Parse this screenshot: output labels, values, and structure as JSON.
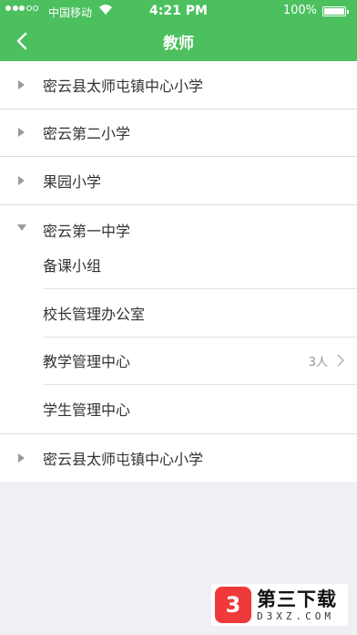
{
  "status_bar": {
    "carrier": "中国移动",
    "time": "4:21 PM",
    "battery": "100%"
  },
  "nav": {
    "title": "教师",
    "back_icon": "chevron-left-icon"
  },
  "schools": [
    {
      "name": "密云县太师屯镇中心小学"
    },
    {
      "name": "密云第二小学"
    },
    {
      "name": "果园小学"
    }
  ],
  "expanded_school": {
    "name": "密云第一中学",
    "groups": [
      {
        "name": "备课小组"
      },
      {
        "name": "校长管理办公室"
      },
      {
        "name": "教学管理中心",
        "count": "3人"
      },
      {
        "name": "学生管理中心"
      }
    ]
  },
  "last_school": {
    "name": "密云县太师屯镇中心小学"
  },
  "watermark": {
    "logo_char": "3",
    "title": "第三下载",
    "subtitle": "D3XZ.COM"
  },
  "colors": {
    "brand_green": "#4cc05f",
    "background": "#efeff4"
  }
}
